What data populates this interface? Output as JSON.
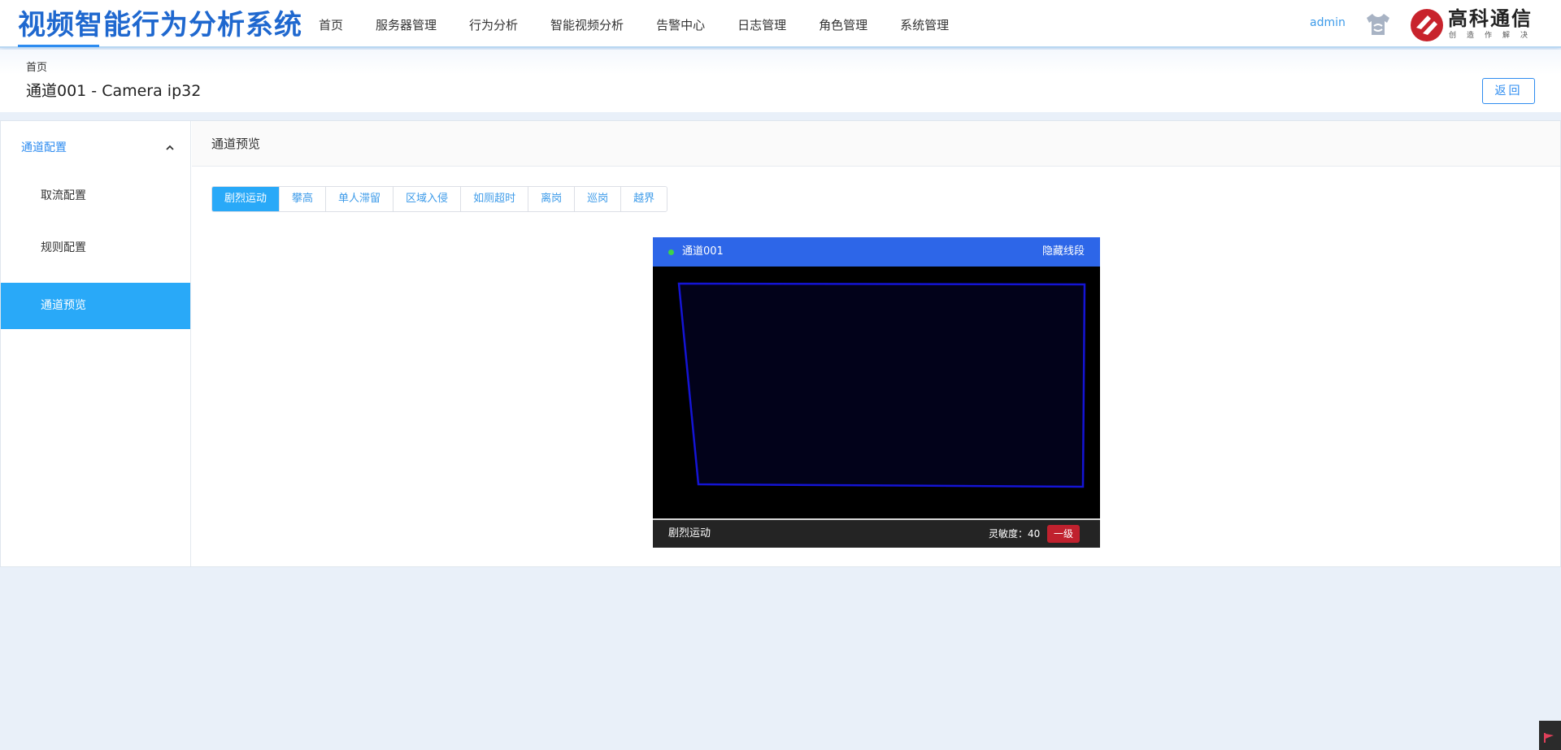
{
  "header": {
    "app_title": "视频智能行为分析系统",
    "nav": [
      "首页",
      "服务器管理",
      "行为分析",
      "智能视频分析",
      "告警中心",
      "日志管理",
      "角色管理",
      "系统管理"
    ],
    "user": "admin",
    "brand": {
      "name": "高科通信",
      "slogan": "创造作解决"
    }
  },
  "page": {
    "breadcrumb": "首页",
    "title": "通道001 - Camera ip32",
    "back_label": "返回"
  },
  "sidebar": {
    "group_label": "通道配置",
    "items": [
      "取流配置",
      "规则配置",
      "通道预览"
    ],
    "active_index": 2
  },
  "main": {
    "title": "通道预览",
    "tabs": [
      "剧烈运动",
      "攀高",
      "单人滞留",
      "区域入侵",
      "如厕超时",
      "离岗",
      "巡岗",
      "越界"
    ],
    "active_tab": 0
  },
  "preview": {
    "channel": "通道001",
    "hide_lines_label": "隐藏线段",
    "rule_name": "剧烈运动",
    "sensitivity_label": "灵敏度：",
    "sensitivity_value": "40",
    "level": "一级"
  },
  "colors": {
    "brand_blue": "#1f68cf",
    "accent": "#29a9f8",
    "video_header": "#2d66e8",
    "zone_line": "#1010d0",
    "level_badge": "#c0212e",
    "status_online": "#3dd34a"
  }
}
